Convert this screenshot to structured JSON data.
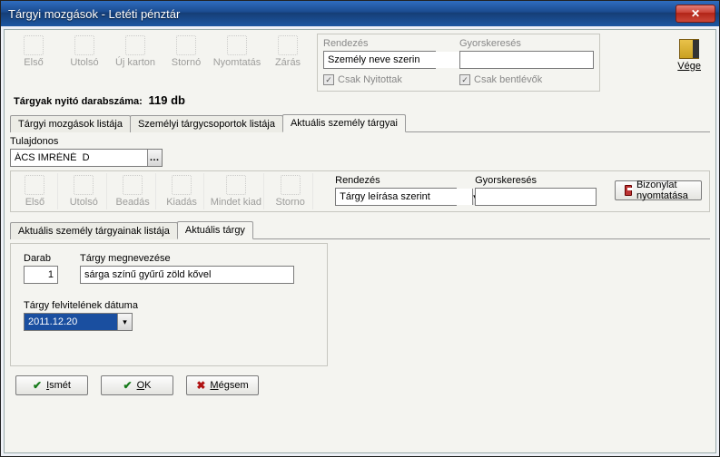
{
  "window": {
    "title": "Tárgyi mozgások - Letéti pénztár",
    "close_icon": "✕",
    "vege_label": "Vége"
  },
  "toolbar_top": {
    "first": "Első",
    "last": "Utolsó",
    "newcard": "Új karton",
    "storno": "Stornó",
    "print": "Nyomtatás",
    "close": "Zárás"
  },
  "sort_top": {
    "rendezes_label": "Rendezés",
    "rendezes_value": "Személy neve szerin",
    "gyorskereses_label": "Gyorskeresés",
    "gyorskereses_value": "",
    "csak_nyitottak": "Csak Nyitottak",
    "csak_bentlevok": "Csak bentlévők"
  },
  "countline": {
    "prefix": "Tárgyak nyitó darabszáma:",
    "value": "119 db"
  },
  "tabs_main": {
    "a": "Tárgyi mozgások listája",
    "b": "Személyi tárgycsoportok listája",
    "c": "Aktuális személy tárgyai"
  },
  "owner": {
    "label": "Tulajdonos",
    "value": "ÁCS IMRÉNÉ  D"
  },
  "toolbar_sub": {
    "first": "Első",
    "last": "Utolsó",
    "beadas": "Beadás",
    "kiadas": "Kiadás",
    "mindetkiad": "Mindet kiad",
    "storno": "Storno"
  },
  "sort_sub": {
    "rendezes_label": "Rendezés",
    "rendezes_value": "Tárgy leírása szerint",
    "gyorskereses_label": "Gyorskeresés",
    "gyorskereses_value": "",
    "bizonylat": "Bizonylat nyomtatása"
  },
  "tabs_inner": {
    "a": "Aktuális személy tárgyainak listája",
    "b": "Aktuális tárgy"
  },
  "form": {
    "darab_label": "Darab",
    "darab_value": "1",
    "megnevezes_label": "Tárgy megnevezése",
    "megnevezes_value": "sárga színű gyűrű zöld kővel",
    "datum_label": "Tárgy felvitelének dátuma",
    "datum_value": "2011.12.20"
  },
  "buttons": {
    "ismet": "Ismét",
    "ok": "OK",
    "megsem": "Mégsem",
    "ismet_key": "I",
    "ok_key": "O",
    "megsem_key": "M"
  }
}
